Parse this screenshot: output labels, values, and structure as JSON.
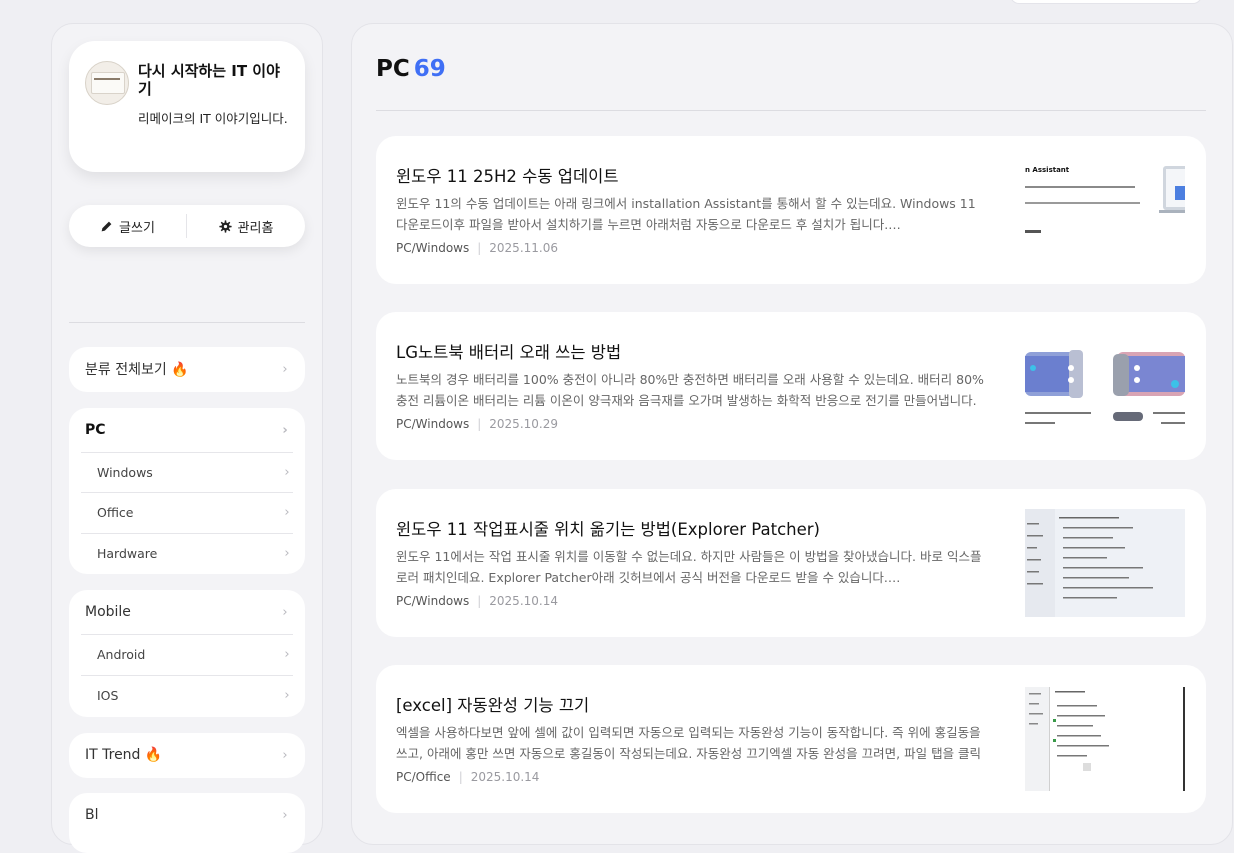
{
  "blog": {
    "title": "다시 시작하는 IT 이야기",
    "description": "리메이크의 IT 이야기입니다."
  },
  "actions": {
    "write_label": "글쓰기",
    "admin_label": "관리홈"
  },
  "sidebar": {
    "all_categories": "분류 전체보기 🔥",
    "pc": {
      "label": "PC",
      "children": [
        "Windows",
        "Office",
        "Hardware"
      ]
    },
    "mobile": {
      "label": "Mobile",
      "children": [
        "Android",
        "IOS"
      ]
    },
    "it_trend": "IT Trend 🔥",
    "partial_next": "Bl"
  },
  "main": {
    "category": "PC",
    "count": "69",
    "posts": [
      {
        "title": "윈도우 11 25H2 수동 업데이트",
        "excerpt": "윈도우 11의 수동 업데이트는 아래 링크에서 installation Assistant를 통해서 할 수 있는데요. Windows 11 다운로드이후 파일을 받아서 설치하기를 누르면 아래처럼 자동으로 다운로드 후 설치가 됩니다.…",
        "category": "PC/Windows",
        "date": "2025.11.06",
        "thumb_text": "n Assistant"
      },
      {
        "title": "LG노트북 배터리 오래 쓰는 방법",
        "excerpt": "노트북의 경우 배터리를 100% 충전이 아니라 80%만 충전하면 배터리를 오래 사용할 수 있는데요. 배터리 80% 충전 리튬이온 배터리는 리튬 이온이 양극재와 음극재를 오가며 발생하는 화학적 반응으로 전기를 만들어냅니다. 전자가 …",
        "category": "PC/Windows",
        "date": "2025.10.29"
      },
      {
        "title": "윈도우 11 작업표시줄 위치 옮기는 방법(Explorer Patcher)",
        "excerpt": "윈도우 11에서는 작업 표시줄 위치를 이동할 수 없는데요. 하지만 사람들은 이 방법을 찾아냈습니다. 바로 익스플로러 패치인데요. Explorer Patcher아래 깃허브에서 공식 버전을 다운로드 받을 수 있습니다.…",
        "category": "PC/Windows",
        "date": "2025.10.14"
      },
      {
        "title": "[excel] 자동완성 기능 끄기",
        "excerpt": "엑셀을 사용하다보면 앞에 셀에 값이 입력되면 자동으로 입력되는 자동완성 기능이 동작합니다. 즉 위에 홍길동을 쓰고, 아래에 홍만 쓰면 자동으로 홍길동이 작성되는데요. 자동완성 끄기엑셀 자동 완성을 끄려면, 파일 탭을 클릭하고 옵션…",
        "category": "PC/Office",
        "date": "2025.10.14"
      }
    ]
  }
}
